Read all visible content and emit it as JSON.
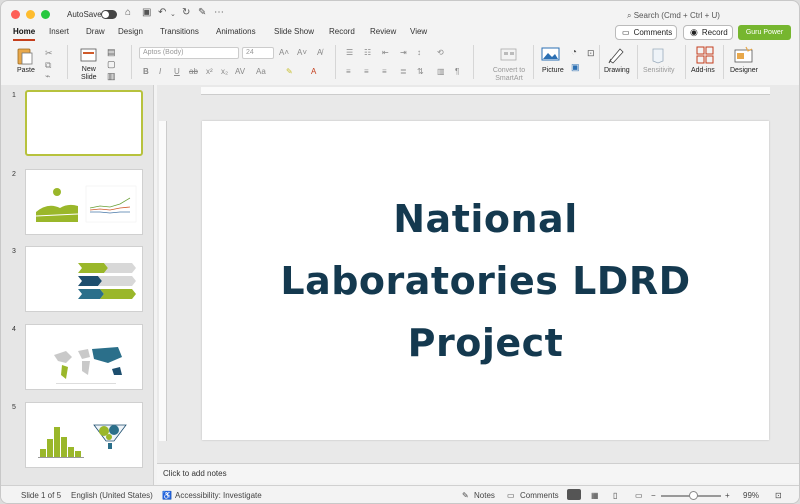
{
  "titlebar": {
    "autosave_label": "AutoSave",
    "search_placeholder": "Search (Cmd + Ctrl + U)"
  },
  "tabs": [
    {
      "label": "Home"
    },
    {
      "label": "Insert"
    },
    {
      "label": "Draw"
    },
    {
      "label": "Design"
    },
    {
      "label": "Transitions"
    },
    {
      "label": "Animations"
    },
    {
      "label": "Slide Show"
    },
    {
      "label": "Record"
    },
    {
      "label": "Review"
    },
    {
      "label": "View"
    }
  ],
  "header_buttons": {
    "comments": "Comments",
    "record": "Record",
    "guru": "Guru Power"
  },
  "ribbon": {
    "paste": "Paste",
    "new_slide_line1": "New",
    "new_slide_line2": "Slide",
    "font_name": "Aptos (Body)",
    "font_size": "24",
    "convert_line1": "Convert to",
    "convert_line2": "SmartArt",
    "picture": "Picture",
    "drawing": "Drawing",
    "sensitivity": "Sensitivity",
    "addins": "Add-ins",
    "designer": "Designer"
  },
  "thumbnails": [
    {
      "number": "1"
    },
    {
      "number": "2"
    },
    {
      "number": "3"
    },
    {
      "number": "4"
    },
    {
      "number": "5"
    }
  ],
  "slide": {
    "title_line1": "National",
    "title_line2": "Laboratories LDRD",
    "title_line3": "Project"
  },
  "notes_placeholder": "Click to add notes",
  "status": {
    "slide_count": "Slide 1 of 5",
    "language": "English (United States)",
    "accessibility": "Accessibility: Investigate",
    "notes": "Notes",
    "comments": "Comments",
    "zoom": "99%"
  },
  "colors": {
    "accent_tab": "#c43e1c",
    "title_color": "#14394f",
    "guru_green": "#76b62f",
    "thumb_select": "#b7c23d"
  }
}
